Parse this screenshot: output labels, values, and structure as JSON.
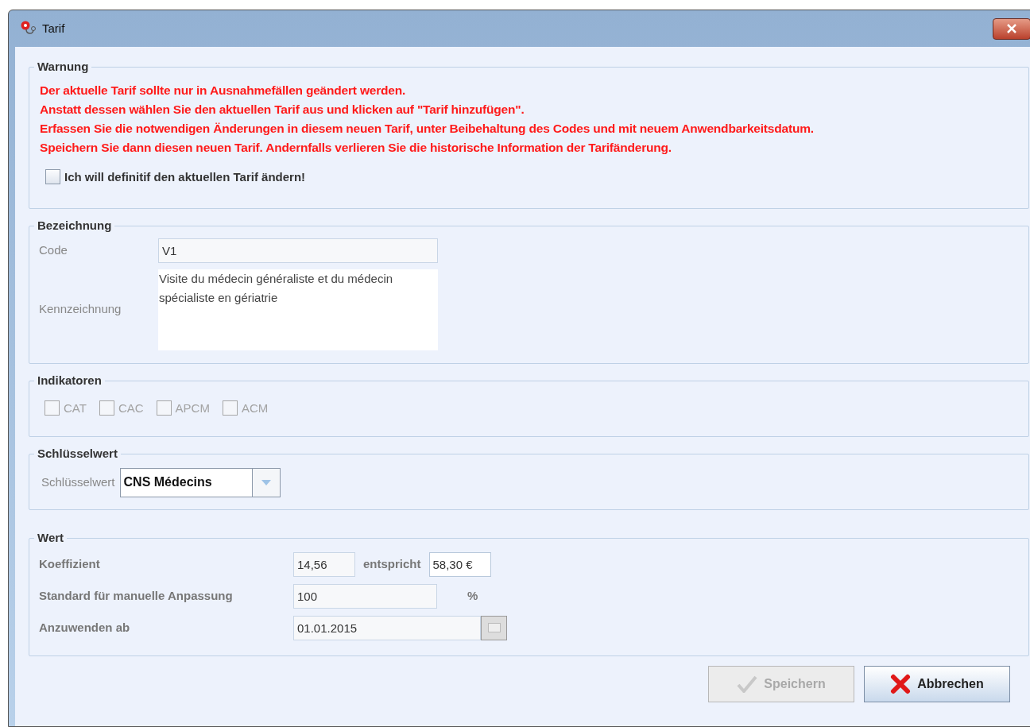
{
  "window": {
    "title": "Tarif"
  },
  "warning": {
    "legend": "Warnung",
    "lines": [
      "Der aktuelle Tarif sollte nur in Ausnahmefällen geändert werden.",
      "Anstatt dessen wählen Sie den aktuellen Tarif aus und klicken auf \"Tarif hinzufügen\".",
      "Erfassen Sie die notwendigen Änderungen in diesem neuen Tarif, unter Beibehaltung des Codes und mit neuem Anwendbarkeitsdatum.",
      "Speichern Sie dann diesen neuen Tarif. Andernfalls verlieren Sie die historische Information der Tarifänderung."
    ],
    "confirm": {
      "label": "Ich will definitif den aktuellen Tarif ändern!",
      "checked": false
    }
  },
  "bezeichnung": {
    "legend": "Bezeichnung",
    "code": {
      "label": "Code",
      "value": "V1",
      "readonly": true
    },
    "kennzeichnung": {
      "label": "Kennzeichnung",
      "value": "Visite du médecin généraliste et du médecin spécialiste en gériatrie",
      "readonly": false
    }
  },
  "indikatoren": {
    "legend": "Indikatoren",
    "items": [
      {
        "label": "CAT",
        "checked": false,
        "disabled": true
      },
      {
        "label": "CAC",
        "checked": false,
        "disabled": true
      },
      {
        "label": "APCM",
        "checked": false,
        "disabled": true
      },
      {
        "label": "ACM",
        "checked": false,
        "disabled": true
      }
    ]
  },
  "schluesselwert": {
    "legend": "Schlüsselwert",
    "label": "Schlüsselwert",
    "value": "CNS Médecins"
  },
  "wert": {
    "legend": "Wert",
    "koeffizient": {
      "label": "Koeffizient",
      "value": "14,56",
      "readonly": true
    },
    "entspricht": {
      "label": "entspricht",
      "value": "58,30 €",
      "readonly": false
    },
    "standard": {
      "label": "Standard für manuelle Anpassung",
      "value": "100",
      "unit": "%",
      "readonly": true
    },
    "anzuwenden": {
      "label": "Anzuwenden ab",
      "value": "01.01.2015",
      "readonly": true
    }
  },
  "buttons": [
    {
      "kind": "save",
      "label": "Speichern",
      "disabled": true
    },
    {
      "kind": "cancel",
      "label": "Abbrechen",
      "disabled": false
    }
  ]
}
